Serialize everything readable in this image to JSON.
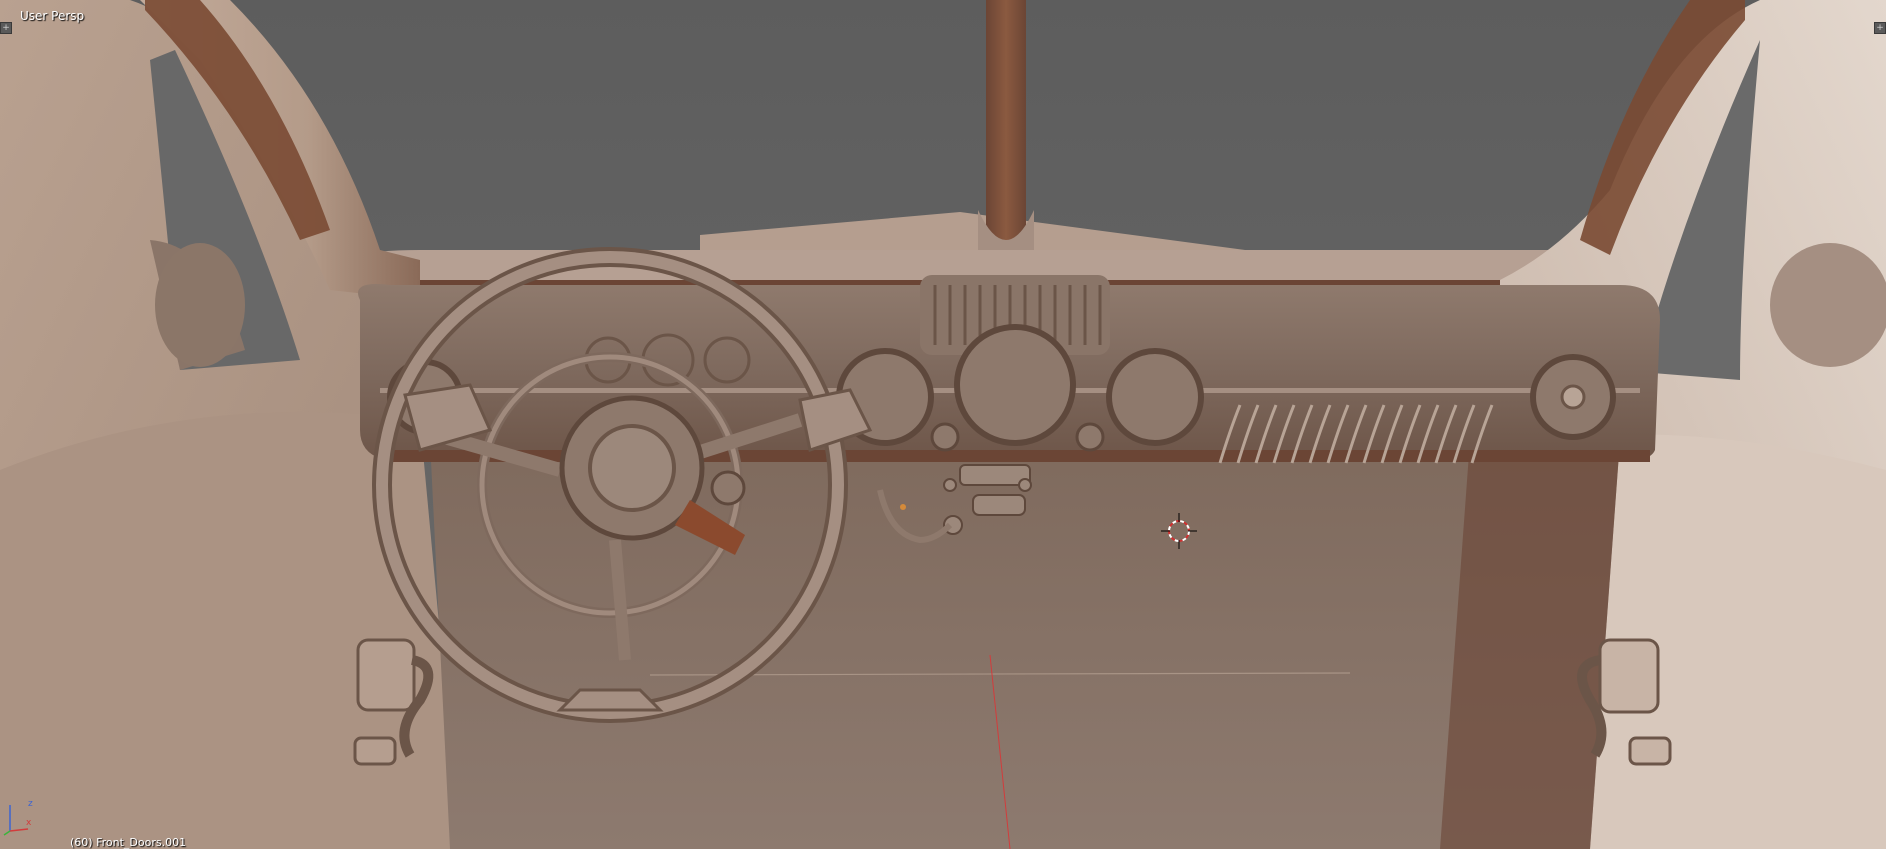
{
  "viewport": {
    "view_name": "User Persp",
    "object_info": "(60) Front_Doors.001",
    "corner_left_icon": "plus-icon",
    "corner_right_icon": "plus-icon",
    "corner_glyph": "+",
    "axis": {
      "x_label": "x",
      "z_label": "z"
    },
    "colors": {
      "background": "#646464",
      "interior": "#a58f82",
      "shadow": "#6b4535",
      "highlight": "#d8c8bc",
      "cursor": "#d03030",
      "x_axis": "#d23c3c",
      "z_axis": "#3c64d2",
      "y_axis": "#3cb43c"
    }
  }
}
